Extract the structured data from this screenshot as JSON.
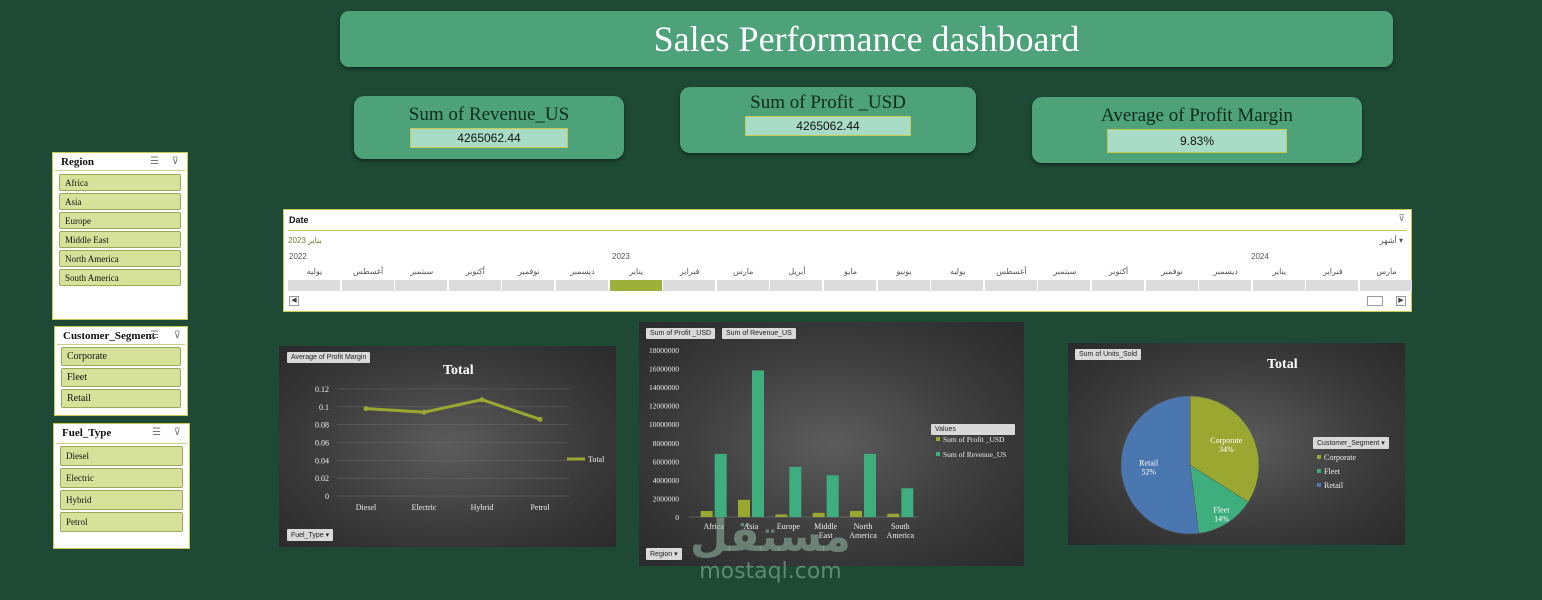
{
  "title": "Sales Performance dashboard",
  "kpis": {
    "revenue": {
      "label": "Sum of Revenue_US",
      "value": "4265062.44"
    },
    "profit": {
      "label": "Sum of Profit _USD",
      "value": "4265062.44"
    },
    "margin": {
      "label": "Average of Profit Margin",
      "value": "9.83%"
    }
  },
  "slicers": {
    "region": {
      "title": "Region",
      "items": [
        "Africa",
        "Asia",
        "Europe",
        "Middle East",
        "North America",
        "South America"
      ]
    },
    "segment": {
      "title": "Customer_Segment",
      "items": [
        "Corporate",
        "Fleet",
        "Retail"
      ]
    },
    "fuel": {
      "title": "Fuel_Type",
      "items": [
        "Diesel",
        "Electric",
        "Hybrid",
        "Petrol"
      ]
    }
  },
  "timeline": {
    "title": "Date",
    "selection": "يناير 2023",
    "level": "أشهر",
    "years": [
      "2022",
      "2023",
      "2024"
    ],
    "months": [
      "يوليه",
      "أغسطس",
      "سبتمبر",
      "أكتوبر",
      "نوفمبر",
      "ديسمبر",
      "يناير",
      "فبراير",
      "مارس",
      "أبريل",
      "مايو",
      "يونيو",
      "يوليه",
      "أغسطس",
      "سبتمبر",
      "أكتوبر",
      "نوفمبر",
      "ديسمبر",
      "يناير",
      "فبراير",
      "مارس"
    ],
    "selected_index": 6
  },
  "charts": {
    "margin_line": {
      "chip": "Average of Profit Margin",
      "title": "Total",
      "filter_chip": "Fuel_Type",
      "legend": "Total",
      "color": "#9aa832"
    },
    "region_bar": {
      "chips": [
        "Sum of Profit _USD",
        "Sum of Revenue_US"
      ],
      "filter_chip": "Region",
      "legend_title": "Values",
      "colors": [
        "#9aa832",
        "#3fae7e"
      ]
    },
    "segment_pie": {
      "chip": "Sum of Units_Sold",
      "title": "Total",
      "legend_title": "Customer_Segment",
      "colors": [
        "#9aa832",
        "#3fae7e",
        "#4a77b0"
      ],
      "slice_labels": [
        "Corporate\n34%",
        "Fleet\n14%",
        "Retail\n52%"
      ]
    }
  },
  "chart_data": [
    {
      "type": "line",
      "title": "Total",
      "categories": [
        "Diesel",
        "Electric",
        "Hybrid",
        "Petrol"
      ],
      "series": [
        {
          "name": "Total",
          "values": [
            0.098,
            0.094,
            0.108,
            0.086
          ]
        }
      ],
      "ylim": [
        0,
        0.12
      ],
      "yticks": [
        "0.12",
        "0.1",
        "0.08",
        "0.06",
        "0.04",
        "0.02",
        "0"
      ],
      "legend": "right"
    },
    {
      "type": "bar",
      "categories": [
        "Africa",
        "Asia",
        "Europe",
        "Middle East",
        "North America",
        "South America"
      ],
      "series": [
        {
          "name": "Sum of Profit _USD",
          "values": [
            650000,
            1850000,
            280000,
            450000,
            650000,
            350000
          ]
        },
        {
          "name": "Sum of Revenue_US",
          "values": [
            6800000,
            15800000,
            5400000,
            4500000,
            6800000,
            3100000
          ]
        }
      ],
      "ylim": [
        0,
        18000000
      ],
      "yticks": [
        "18000000",
        "16000000",
        "14000000",
        "12000000",
        "10000000",
        "8000000",
        "6000000",
        "4000000",
        "2000000",
        "0"
      ],
      "legend": "right"
    },
    {
      "type": "pie",
      "title": "Total",
      "categories": [
        "Corporate",
        "Fleet",
        "Retail"
      ],
      "values": [
        34,
        14,
        52
      ],
      "legend": "right"
    }
  ],
  "watermark": {
    "ar": "مستقل",
    "en": "mostaql.com"
  }
}
